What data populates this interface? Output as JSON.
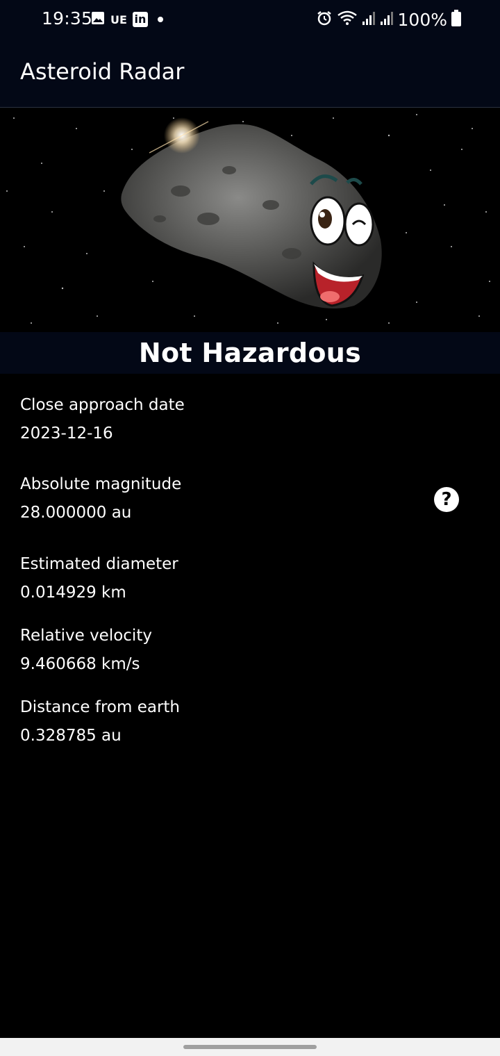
{
  "status_bar": {
    "time": "19:35",
    "notification_icons": [
      "gallery-icon",
      "ue-icon",
      "linkedin-icon",
      "dot-icon"
    ],
    "ue_text": "UE",
    "linkedin_text": "in",
    "system_icons": [
      "alarm-icon",
      "wifi-icon",
      "signal-icon",
      "signal-icon",
      "battery-icon"
    ],
    "battery": "100%"
  },
  "app_bar": {
    "title": "Asteroid Radar"
  },
  "hero": {
    "image": "asteroid-happy-image",
    "status_label": "Not Hazardous"
  },
  "details": {
    "close_approach": {
      "label": "Close approach date",
      "value": "2023-12-16"
    },
    "absolute_magnitude": {
      "label": "Absolute magnitude",
      "value": "28.000000 au"
    },
    "estimated_diameter": {
      "label": "Estimated diameter",
      "value": "0.014929 km"
    },
    "relative_velocity": {
      "label": "Relative velocity",
      "value": "9.460668 km/s"
    },
    "distance_from_earth": {
      "label": "Distance from earth",
      "value": "0.328785 au"
    }
  },
  "help_button": {
    "icon": "help-circle-icon",
    "glyph": "?"
  },
  "colors": {
    "background": "#000000",
    "bar": "#030816",
    "text": "#ffffff"
  }
}
